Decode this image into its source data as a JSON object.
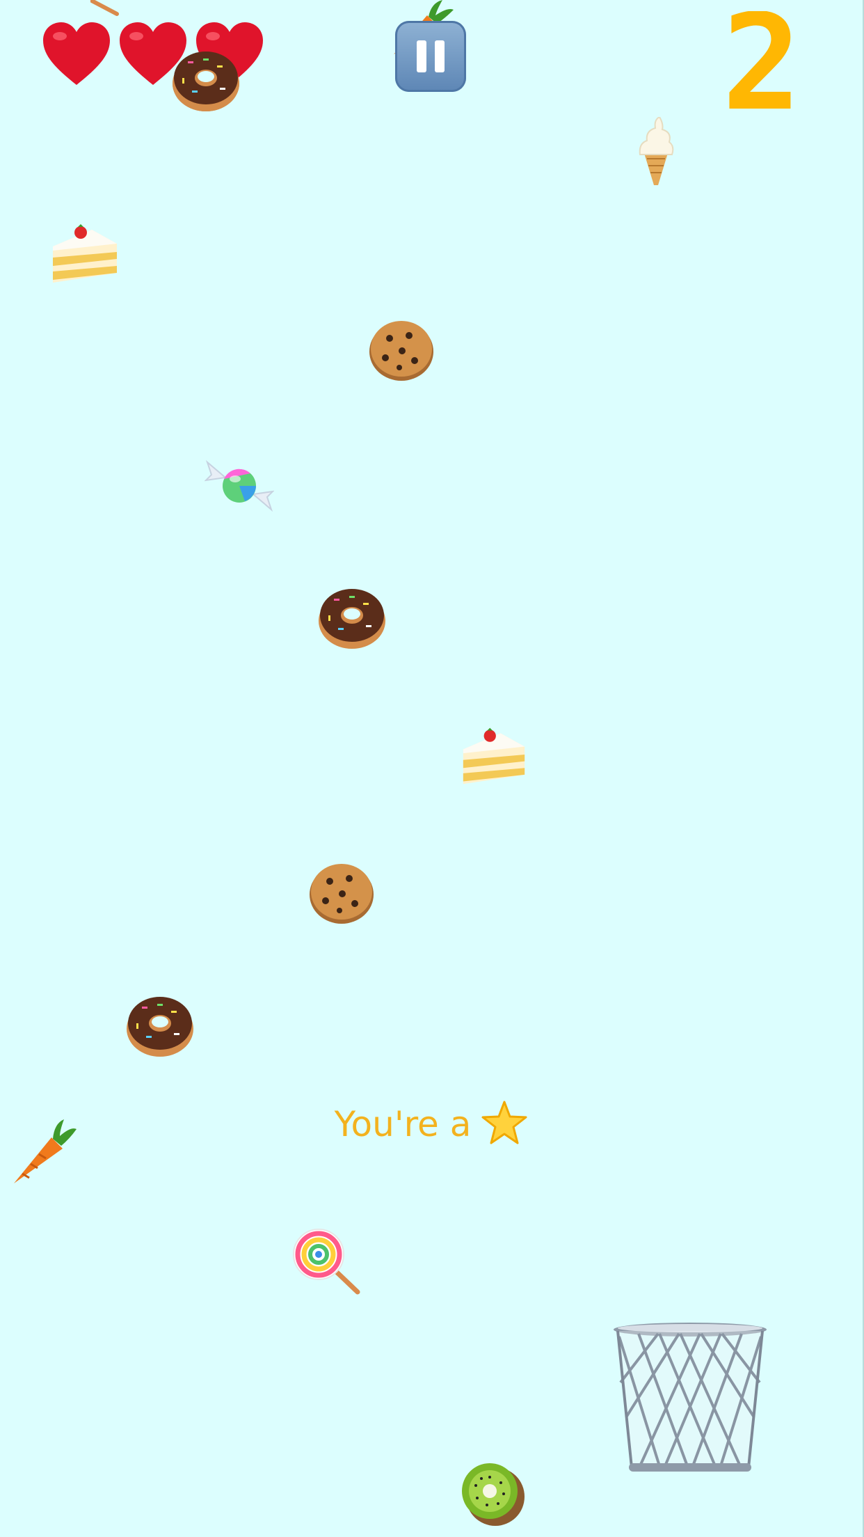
{
  "hud": {
    "lives": 3,
    "score": "2",
    "pause": {
      "icon": "pause-icon"
    }
  },
  "falling_items": [
    {
      "icon": "carrot-icon"
    },
    {
      "icon": "doughnut-icon"
    },
    {
      "icon": "soft-ice-cream-icon"
    },
    {
      "icon": "shortcake-icon"
    },
    {
      "icon": "cookie-icon"
    },
    {
      "icon": "candy-icon"
    },
    {
      "icon": "doughnut-icon"
    },
    {
      "icon": "shortcake-icon"
    },
    {
      "icon": "cookie-icon"
    },
    {
      "icon": "doughnut-icon"
    },
    {
      "icon": "carrot-icon"
    },
    {
      "icon": "lollipop-icon"
    },
    {
      "icon": "kiwi-icon"
    },
    {
      "icon": "lollipop-stick-icon"
    }
  ],
  "message": {
    "text": "You're a",
    "icon": "star-icon"
  },
  "basket": {
    "icon": "wastebasket-icon"
  },
  "colors": {
    "background": "#dcfefe",
    "score": "#ffb703",
    "message": "#f3b21e",
    "pause_button": "#6f94bf",
    "heart": "#e0142b"
  }
}
